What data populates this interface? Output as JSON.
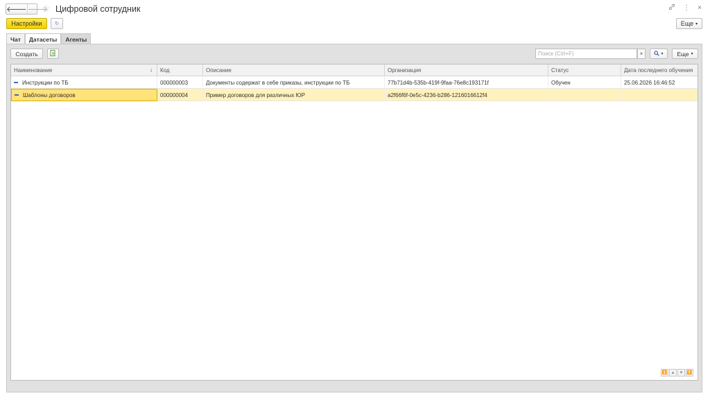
{
  "window": {
    "title": "Цифровой сотрудник",
    "back_icon": "arrow-left-icon",
    "forward_icon": "arrow-right-icon",
    "favorite_icon": "star-icon",
    "link_icon": "link-icon",
    "menu_icon": "kebab-icon",
    "close_icon": "close-icon"
  },
  "toolbar": {
    "settings_label": "Настройки",
    "more_label": "Еще"
  },
  "tabs": [
    {
      "label": "Чат"
    },
    {
      "label": "Датасеты"
    },
    {
      "label": "Агенты"
    }
  ],
  "list_toolbar": {
    "create_label": "Создать",
    "search_placeholder": "Поиск (Ctrl+F)",
    "search_value": "",
    "clear_label": "×",
    "more_label": "Еще"
  },
  "table": {
    "columns": [
      "Наименование",
      "Код",
      "Описание",
      "Организация",
      "Статус",
      "Дата последнего обучения"
    ],
    "sort_indicator": "↓",
    "rows": [
      {
        "name": "Инструкции по ТБ",
        "code": "000000003",
        "description": "Документы содержат в себе приказы, инструкции по ТБ",
        "organization": "77b71d4b-535b-419f-9faa-76e8c193171f",
        "status": "Обучен",
        "date": "25.06.2026 16:46:52",
        "selected": false
      },
      {
        "name": "Шаблоны договоров",
        "code": "000000004",
        "description": "Пример договоров для различных ЮР",
        "organization": "a2f66f6f-0e5c-4236-b286-1216016612f4",
        "status": "",
        "date": "",
        "selected": true
      }
    ]
  },
  "colors": {
    "accent_yellow": "#f5d31a",
    "selected_row": "#fff2bd",
    "row_icon": "#3f69b7"
  }
}
